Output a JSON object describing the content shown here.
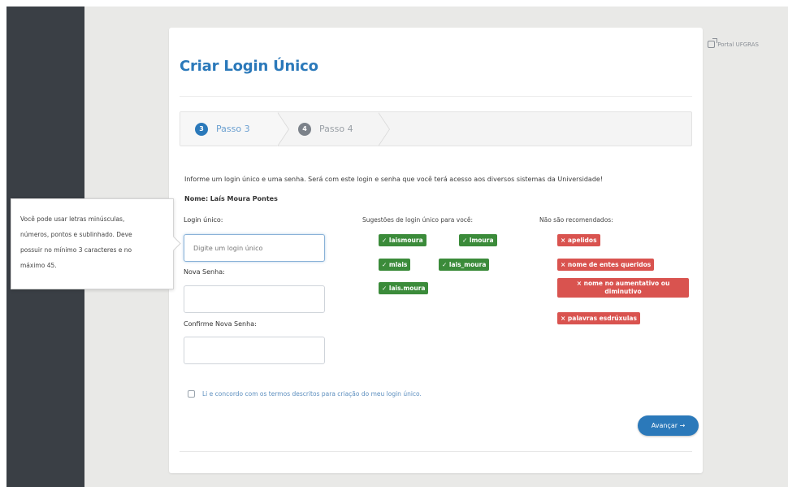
{
  "portal_link": "Portal UFGRAS",
  "title": "Criar Login Único",
  "steps": [
    {
      "number": "3",
      "label": "Passo 3"
    },
    {
      "number": "4",
      "label": "Passo 4"
    }
  ],
  "info_text": "Informe um login único e uma senha. Será com este login e senha que você terá acesso aos diversos sistemas da Universidade!",
  "name": {
    "label": "Nome:",
    "value": "Laís Moura Pontes"
  },
  "fields": {
    "login": {
      "label": "Login único:",
      "placeholder": "Digite um login único"
    },
    "password": {
      "label": "Nova Senha:"
    },
    "confirm": {
      "label": "Confirme Nova Senha:"
    }
  },
  "tooltip": [
    "Você pode usar letras minúsculas,",
    "números, pontos e sublinhado. Deve",
    "possuir no mínimo 3 caracteres e no",
    "máximo 45."
  ],
  "suggestions_title": "Sugestões de login único para você:",
  "suggestions": [
    "✓ laismoura",
    "✓ lmoura",
    "✓ mlais",
    "✓ lais_moura",
    "✓ lais.moura"
  ],
  "not_recommended_title": "Não são recomendados:",
  "not_recommended": [
    "× apelidos",
    "× nome de entes queridos",
    "× nome no aumentativo ou diminutivo",
    "× palavras esdrúxulas"
  ],
  "terms_text": "Li e concordo com os termos descritos para criação do meu login único.",
  "advance_button": "Avançar →",
  "colors": {
    "primary": "#2b79ba",
    "success": "#3b8b3a",
    "danger": "#d9534f",
    "sidebar": "#3a3f45"
  }
}
